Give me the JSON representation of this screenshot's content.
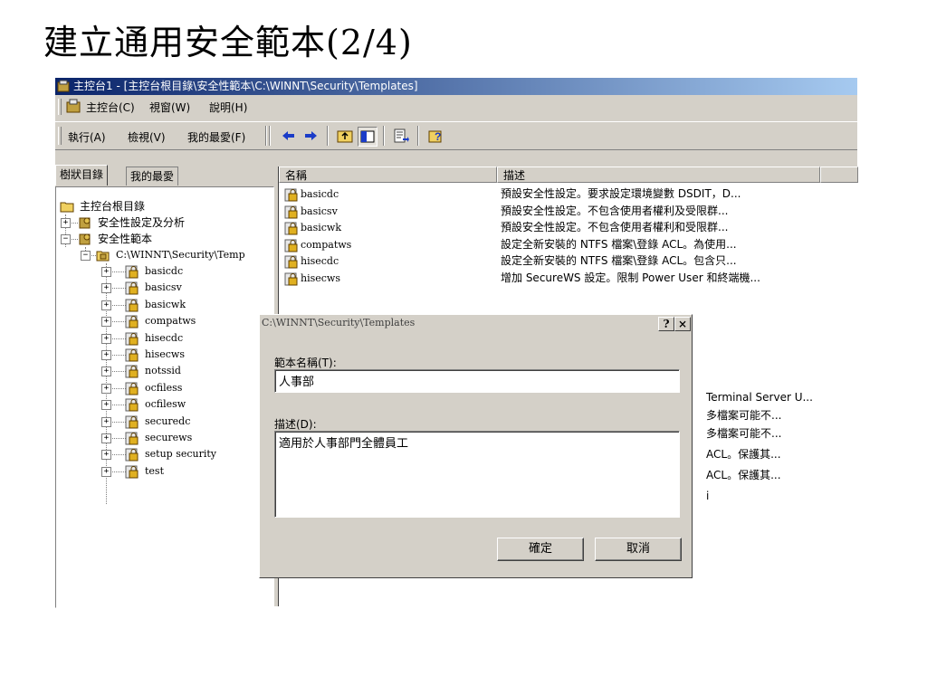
{
  "slide": {
    "title": "建立通用安全範本(2/4)"
  },
  "window": {
    "title": "主控台1 - [主控台根目錄\\安全性範本\\C:\\WINNT\\Security\\Templates]",
    "menu": [
      "主控台(C)",
      "視窗(W)",
      "說明(H)"
    ],
    "toolbar": {
      "action_label": "執行(A)",
      "view_label": "檢視(V)",
      "favorites_label": "我的最愛(F)"
    },
    "tabs": [
      "樹狀目錄",
      "我的最愛"
    ],
    "tree": {
      "root": "主控台根目錄",
      "nodes": [
        "安全性設定及分析",
        "安全性範本"
      ],
      "path": "C:\\WINNT\\Security\\Temp",
      "templates": [
        "basicdc",
        "basicsv",
        "basicwk",
        "compatws",
        "hisecdc",
        "hisecws",
        "notssid",
        "ocfiless",
        "ocfilesw",
        "securedc",
        "securews",
        "setup security",
        "test"
      ]
    },
    "list": {
      "columns": [
        "名稱",
        "描述"
      ],
      "rows": [
        {
          "name": "basicdc",
          "desc": "預設安全性設定。要求設定環境變數 DSDIT，D..."
        },
        {
          "name": "basicsv",
          "desc": "預設安全性設定。不包含使用者權利及受限群..."
        },
        {
          "name": "basicwk",
          "desc": "預設安全性設定。不包含使用者權利和受限群..."
        },
        {
          "name": "compatws",
          "desc": "設定全新安裝的 NTFS 檔案\\登錄 ACL。為使用..."
        },
        {
          "name": "hisecdc",
          "desc": "設定全新安裝的 NTFS 檔案\\登錄 ACL。包含只..."
        },
        {
          "name": "hisecws",
          "desc": "增加 SecureWS 設定。限制 Power User 和終端機..."
        }
      ],
      "partial_descs": [
        "Terminal Server U...",
        "多檔案可能不...",
        "多檔案可能不...",
        "ACL。保護其...",
        "ACL。保護其...",
        "i"
      ]
    }
  },
  "dialog": {
    "title": "C:\\WINNT\\Security\\Templates",
    "help_btn": "?",
    "close_btn": "×",
    "name_label": "範本名稱(T):",
    "name_value": "人事部",
    "desc_label": "描述(D):",
    "desc_value": "適用於人事部門全體員工",
    "ok_label": "確定",
    "cancel_label": "取消"
  }
}
